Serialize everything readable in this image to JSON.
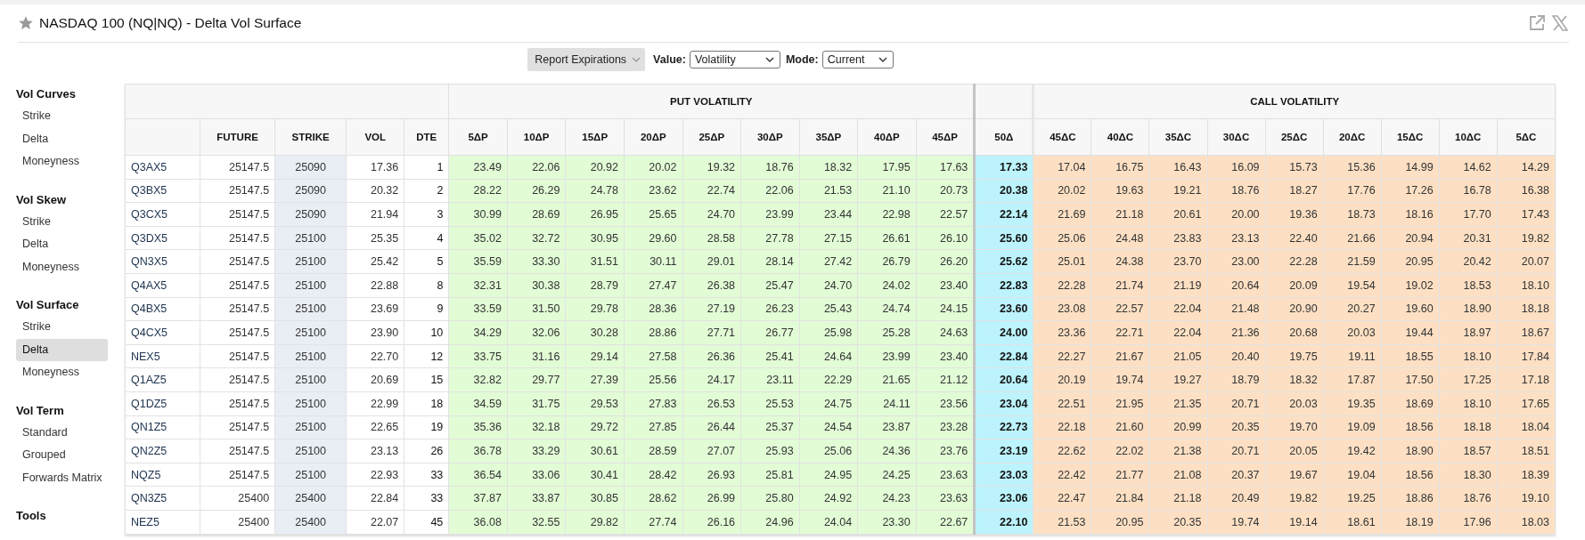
{
  "window": {
    "title": "NASDAQ 100 (NQ|NQ) - Delta Vol Surface",
    "favorite": false
  },
  "toolbar": {
    "report_button": "Report Expirations",
    "controls": [
      {
        "label": "Value:",
        "value": "Volatility"
      },
      {
        "label": "Mode:",
        "value": "Current"
      }
    ]
  },
  "sidebar": {
    "sections": [
      {
        "title": "Vol Curves",
        "items": [
          {
            "label": "Strike",
            "selected": false
          },
          {
            "label": "Delta",
            "selected": false
          },
          {
            "label": "Moneyness",
            "selected": false
          }
        ]
      },
      {
        "title": "Vol Skew",
        "items": [
          {
            "label": "Strike",
            "selected": false
          },
          {
            "label": "Delta",
            "selected": false
          },
          {
            "label": "Moneyness",
            "selected": false
          }
        ]
      },
      {
        "title": "Vol Surface",
        "items": [
          {
            "label": "Strike",
            "selected": false
          },
          {
            "label": "Delta",
            "selected": true
          },
          {
            "label": "Moneyness",
            "selected": false
          }
        ]
      },
      {
        "title": "Vol Term",
        "items": [
          {
            "label": "Standard",
            "selected": false
          },
          {
            "label": "Grouped",
            "selected": false
          },
          {
            "label": "Forwards Matrix",
            "selected": false
          }
        ]
      },
      {
        "title": "Tools"
      }
    ]
  },
  "table": {
    "groups": [
      {
        "kind": "info"
      },
      {
        "kind": "put",
        "label": "PUT VOLATILITY"
      },
      {
        "kind": "atm"
      },
      {
        "kind": "call",
        "label": "CALL VOLATILITY"
      }
    ],
    "columns": [
      {
        "kind": "name"
      },
      {
        "kind": "value",
        "label": "FUTURE"
      },
      {
        "kind": "strike",
        "label": "STRIKE"
      },
      {
        "kind": "vol",
        "label": "VOL"
      },
      {
        "kind": "dte",
        "label": "DTE"
      },
      {
        "kind": "put",
        "label": "5ΔP"
      },
      {
        "kind": "put",
        "label": "10ΔP"
      },
      {
        "kind": "put",
        "label": "15ΔP"
      },
      {
        "kind": "put",
        "label": "20ΔP"
      },
      {
        "kind": "put",
        "label": "25ΔP"
      },
      {
        "kind": "put",
        "label": "30ΔP"
      },
      {
        "kind": "put",
        "label": "35ΔP"
      },
      {
        "kind": "put",
        "label": "40ΔP"
      },
      {
        "kind": "put",
        "label": "45ΔP"
      },
      {
        "kind": "atm",
        "label": "50Δ"
      },
      {
        "kind": "call",
        "label": "45ΔC"
      },
      {
        "kind": "call",
        "label": "40ΔC"
      },
      {
        "kind": "call",
        "label": "35ΔC"
      },
      {
        "kind": "call",
        "label": "30ΔC"
      },
      {
        "kind": "call",
        "label": "25ΔC"
      },
      {
        "kind": "call",
        "label": "20ΔC"
      },
      {
        "kind": "call",
        "label": "15ΔC"
      },
      {
        "kind": "call",
        "label": "10ΔC"
      },
      {
        "kind": "call",
        "label": "5ΔC"
      }
    ],
    "rows": [
      [
        "Q3AX5",
        "25147.5",
        "25090",
        "17.36",
        "1",
        "23.49",
        "22.06",
        "20.92",
        "20.02",
        "19.32",
        "18.76",
        "18.32",
        "17.95",
        "17.63",
        "17.33",
        "17.04",
        "16.75",
        "16.43",
        "16.09",
        "15.73",
        "15.36",
        "14.99",
        "14.62",
        "14.29"
      ],
      [
        "Q3BX5",
        "25147.5",
        "25090",
        "20.32",
        "2",
        "28.22",
        "26.29",
        "24.78",
        "23.62",
        "22.74",
        "22.06",
        "21.53",
        "21.10",
        "20.73",
        "20.38",
        "20.02",
        "19.63",
        "19.21",
        "18.76",
        "18.27",
        "17.76",
        "17.26",
        "16.78",
        "16.38"
      ],
      [
        "Q3CX5",
        "25147.5",
        "25090",
        "21.94",
        "3",
        "30.99",
        "28.69",
        "26.95",
        "25.65",
        "24.70",
        "23.99",
        "23.44",
        "22.98",
        "22.57",
        "22.14",
        "21.69",
        "21.18",
        "20.61",
        "20.00",
        "19.36",
        "18.73",
        "18.16",
        "17.70",
        "17.43"
      ],
      [
        "Q3DX5",
        "25147.5",
        "25100",
        "25.35",
        "4",
        "35.02",
        "32.72",
        "30.95",
        "29.60",
        "28.58",
        "27.78",
        "27.15",
        "26.61",
        "26.10",
        "25.60",
        "25.06",
        "24.48",
        "23.83",
        "23.13",
        "22.40",
        "21.66",
        "20.94",
        "20.31",
        "19.82"
      ],
      [
        "QN3X5",
        "25147.5",
        "25100",
        "25.42",
        "5",
        "35.59",
        "33.30",
        "31.51",
        "30.11",
        "29.01",
        "28.14",
        "27.42",
        "26.79",
        "26.20",
        "25.62",
        "25.01",
        "24.38",
        "23.70",
        "23.00",
        "22.28",
        "21.59",
        "20.95",
        "20.42",
        "20.07"
      ],
      [
        "Q4AX5",
        "25147.5",
        "25100",
        "22.88",
        "8",
        "32.31",
        "30.38",
        "28.79",
        "27.47",
        "26.38",
        "25.47",
        "24.70",
        "24.02",
        "23.40",
        "22.83",
        "22.28",
        "21.74",
        "21.19",
        "20.64",
        "20.09",
        "19.54",
        "19.02",
        "18.53",
        "18.10"
      ],
      [
        "Q4BX5",
        "25147.5",
        "25100",
        "23.69",
        "9",
        "33.59",
        "31.50",
        "29.78",
        "28.36",
        "27.19",
        "26.23",
        "25.43",
        "24.74",
        "24.15",
        "23.60",
        "23.08",
        "22.57",
        "22.04",
        "21.48",
        "20.90",
        "20.27",
        "19.60",
        "18.90",
        "18.18"
      ],
      [
        "Q4CX5",
        "25147.5",
        "25100",
        "23.90",
        "10",
        "34.29",
        "32.06",
        "30.28",
        "28.86",
        "27.71",
        "26.77",
        "25.98",
        "25.28",
        "24.63",
        "24.00",
        "23.36",
        "22.71",
        "22.04",
        "21.36",
        "20.68",
        "20.03",
        "19.44",
        "18.97",
        "18.67"
      ],
      [
        "NEX5",
        "25147.5",
        "25100",
        "22.70",
        "12",
        "33.75",
        "31.16",
        "29.14",
        "27.58",
        "26.36",
        "25.41",
        "24.64",
        "23.99",
        "23.40",
        "22.84",
        "22.27",
        "21.67",
        "21.05",
        "20.40",
        "19.75",
        "19.11",
        "18.55",
        "18.10",
        "17.84"
      ],
      [
        "Q1AZ5",
        "25147.5",
        "25100",
        "20.69",
        "15",
        "32.82",
        "29.77",
        "27.39",
        "25.56",
        "24.17",
        "23.11",
        "22.29",
        "21.65",
        "21.12",
        "20.64",
        "20.19",
        "19.74",
        "19.27",
        "18.79",
        "18.32",
        "17.87",
        "17.50",
        "17.25",
        "17.18"
      ],
      [
        "Q1DZ5",
        "25147.5",
        "25100",
        "22.99",
        "18",
        "34.59",
        "31.75",
        "29.53",
        "27.83",
        "26.53",
        "25.53",
        "24.75",
        "24.11",
        "23.56",
        "23.04",
        "22.51",
        "21.95",
        "21.35",
        "20.71",
        "20.03",
        "19.35",
        "18.69",
        "18.10",
        "17.65"
      ],
      [
        "QN1Z5",
        "25147.5",
        "25100",
        "22.65",
        "19",
        "35.36",
        "32.18",
        "29.72",
        "27.85",
        "26.44",
        "25.37",
        "24.54",
        "23.87",
        "23.28",
        "22.73",
        "22.18",
        "21.60",
        "20.99",
        "20.35",
        "19.70",
        "19.09",
        "18.56",
        "18.18",
        "18.04"
      ],
      [
        "QN2Z5",
        "25147.5",
        "25100",
        "23.13",
        "26",
        "36.78",
        "33.29",
        "30.61",
        "28.59",
        "27.07",
        "25.93",
        "25.06",
        "24.36",
        "23.76",
        "23.19",
        "22.62",
        "22.02",
        "21.38",
        "20.71",
        "20.05",
        "19.42",
        "18.90",
        "18.57",
        "18.51"
      ],
      [
        "NQZ5",
        "25147.5",
        "25100",
        "22.93",
        "33",
        "36.54",
        "33.06",
        "30.41",
        "28.42",
        "26.93",
        "25.81",
        "24.95",
        "24.25",
        "23.63",
        "23.03",
        "22.42",
        "21.77",
        "21.08",
        "20.37",
        "19.67",
        "19.04",
        "18.56",
        "18.30",
        "18.39"
      ],
      [
        "QN3Z5",
        "25400",
        "25400",
        "22.84",
        "33",
        "37.87",
        "33.87",
        "30.85",
        "28.62",
        "26.99",
        "25.80",
        "24.92",
        "24.23",
        "23.63",
        "23.06",
        "22.47",
        "21.84",
        "21.18",
        "20.49",
        "19.82",
        "19.25",
        "18.86",
        "18.76",
        "19.10"
      ],
      [
        "NEZ5",
        "25400",
        "25400",
        "22.07",
        "45",
        "36.08",
        "32.55",
        "29.82",
        "27.74",
        "26.16",
        "24.96",
        "24.04",
        "23.30",
        "22.67",
        "22.10",
        "21.53",
        "20.95",
        "20.35",
        "19.74",
        "19.14",
        "18.61",
        "18.19",
        "17.96",
        "18.03"
      ]
    ]
  }
}
